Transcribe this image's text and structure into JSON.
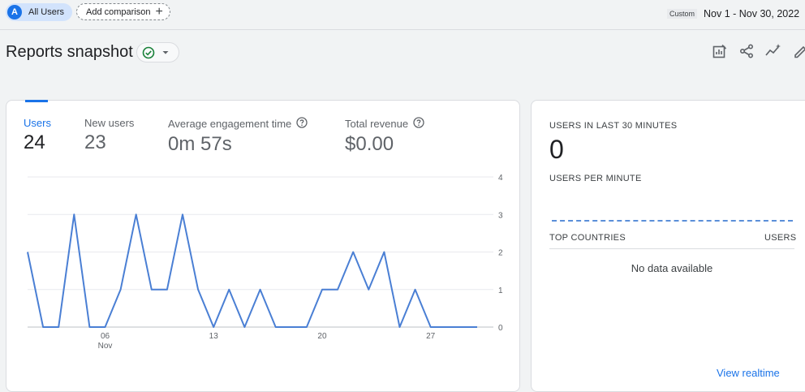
{
  "header": {
    "segment_avatar": "A",
    "segment_label": "All Users",
    "add_comparison_label": "Add comparison",
    "custom_badge": "Custom",
    "date_range": "Nov 1 - Nov 30, 2022"
  },
  "page": {
    "title": "Reports snapshot"
  },
  "toolbar_icons": [
    "customize-report-icon",
    "share-icon",
    "insights-icon",
    "edit-icon"
  ],
  "metrics": [
    {
      "label": "Users",
      "value": "24",
      "active": true,
      "help": false
    },
    {
      "label": "New users",
      "value": "23",
      "active": false,
      "help": false
    },
    {
      "label": "Average engagement time",
      "value": "0m 57s",
      "active": false,
      "help": true
    },
    {
      "label": "Total revenue",
      "value": "$0.00",
      "active": false,
      "help": true
    }
  ],
  "chart_data": {
    "type": "line",
    "x": [
      "2022-11-01",
      "2022-11-02",
      "2022-11-03",
      "2022-11-04",
      "2022-11-05",
      "2022-11-06",
      "2022-11-07",
      "2022-11-08",
      "2022-11-09",
      "2022-11-10",
      "2022-11-11",
      "2022-11-12",
      "2022-11-13",
      "2022-11-14",
      "2022-11-15",
      "2022-11-16",
      "2022-11-17",
      "2022-11-18",
      "2022-11-19",
      "2022-11-20",
      "2022-11-21",
      "2022-11-22",
      "2022-11-23",
      "2022-11-24",
      "2022-11-25",
      "2022-11-26",
      "2022-11-27",
      "2022-11-28",
      "2022-11-29",
      "2022-11-30"
    ],
    "series": [
      {
        "values": [
          2,
          0,
          0,
          3,
          0,
          0,
          1,
          3,
          1,
          1,
          3,
          1,
          0,
          1,
          0,
          1,
          0,
          0,
          0,
          1,
          1,
          2,
          1,
          2,
          0,
          1,
          0,
          0,
          0,
          0
        ],
        "color": "#4a7fd4"
      }
    ],
    "ylim": [
      0,
      4
    ],
    "yticks": [
      "0",
      "1",
      "2",
      "3",
      "4"
    ],
    "xtick_labels": [
      {
        "at": "2022-11-06",
        "label": "06",
        "sub": "Nov"
      },
      {
        "at": "2022-11-13",
        "label": "13",
        "sub": ""
      },
      {
        "at": "2022-11-20",
        "label": "20",
        "sub": ""
      },
      {
        "at": "2022-11-27",
        "label": "27",
        "sub": ""
      }
    ],
    "grid": true
  },
  "realtime": {
    "users_30_label": "USERS IN LAST 30 MINUTES",
    "users_30_value": "0",
    "per_minute_label": "USERS PER MINUTE",
    "countries_label": "TOP COUNTRIES",
    "users_col_label": "USERS",
    "empty_text": "No data available",
    "view_link": "View realtime"
  },
  "colors": {
    "accent": "#1a73e8",
    "segment_chip": "#d2e3fc",
    "check_ok": "#188038"
  }
}
